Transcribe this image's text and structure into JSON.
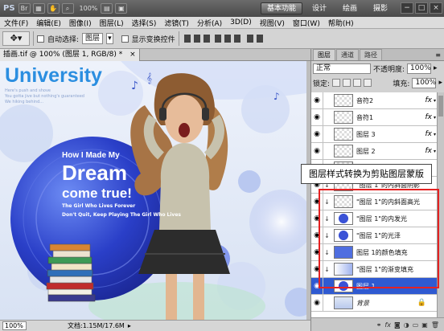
{
  "titlebar": {
    "logo": "PS",
    "zoom": "100%",
    "workspaces": [
      "基本功能",
      "设计",
      "绘画",
      "摄影"
    ],
    "window_controls": [
      "−",
      "□",
      "×"
    ]
  },
  "menu": [
    "文件(F)",
    "编辑(E)",
    "图像(I)",
    "图层(L)",
    "选择(S)",
    "滤镜(T)",
    "分析(A)",
    "3D(D)",
    "视图(V)",
    "窗口(W)",
    "帮助(H)"
  ],
  "options": {
    "auto_select_label": "自动选择:",
    "auto_select_value": "图层",
    "show_transform_label": "显示变换控件"
  },
  "document": {
    "tab_title": "插画.tif @ 100% (图层 1, RGB/8) *",
    "close": "×"
  },
  "canvas": {
    "university": "University",
    "small_text_1": "Here's push and shove",
    "small_text_2": "You gotta jive but nothing's guaranteed",
    "small_text_3": "We hiking behind...",
    "how": "How I Made My",
    "dream": "Dream",
    "come_true": "come true!",
    "girl_line_1": "The Girl Who Lives Forever",
    "girl_line_2": "Don't Quit, Keep Playing The Girl Who Lives"
  },
  "status": {
    "zoom": "100%",
    "doc_info": "文档:1.15M/17.6M"
  },
  "panel": {
    "tabs": [
      "图层",
      "通道",
      "路径"
    ],
    "blend_mode": "正常",
    "opacity_label": "不透明度:",
    "opacity_value": "100%",
    "lock_label": "锁定:",
    "fill_label": "填充:",
    "fill_value": "100%"
  },
  "layers": [
    {
      "name": "音符2",
      "fx": true,
      "clipped": false,
      "thumb": "checker"
    },
    {
      "name": "音符1",
      "fx": true,
      "clipped": false,
      "thumb": "checker"
    },
    {
      "name": "图层 3",
      "fx": true,
      "clipped": false,
      "thumb": "checker"
    },
    {
      "name": "图层 2",
      "fx": true,
      "clipped": false,
      "thumb": "checker"
    },
    {
      "name": "",
      "fx": false,
      "clipped": false,
      "thumb": "checker"
    },
    {
      "name": "\"图层 1\"的内斜面阴影",
      "fx": false,
      "clipped": true,
      "thumb": "checker"
    },
    {
      "name": "\"图层 1\"的内斜面高光",
      "fx": false,
      "clipped": true,
      "thumb": "checker"
    },
    {
      "name": "\"图层 1\"的内发光",
      "fx": false,
      "clipped": true,
      "thumb": "blue-circle"
    },
    {
      "name": "\"图层 1\"的光泽",
      "fx": false,
      "clipped": true,
      "thumb": "blue-circle"
    },
    {
      "name": "图层 1的颜色填充",
      "fx": false,
      "clipped": true,
      "thumb": "blue"
    },
    {
      "name": "\"图层 1\"的渐变填充",
      "fx": false,
      "clipped": true,
      "thumb": "gradient"
    },
    {
      "name": "图层 1",
      "fx": false,
      "clipped": false,
      "thumb": "blue-circle",
      "selected": true
    },
    {
      "name": "背景",
      "fx": false,
      "clipped": false,
      "thumb": "photo",
      "italic": true
    }
  ],
  "callout": "图层样式转换为剪贴图层蒙版",
  "colors": {
    "selection": "#2f5ad1",
    "highlight_box": "#e52222",
    "sphere": "#3a52d6"
  }
}
